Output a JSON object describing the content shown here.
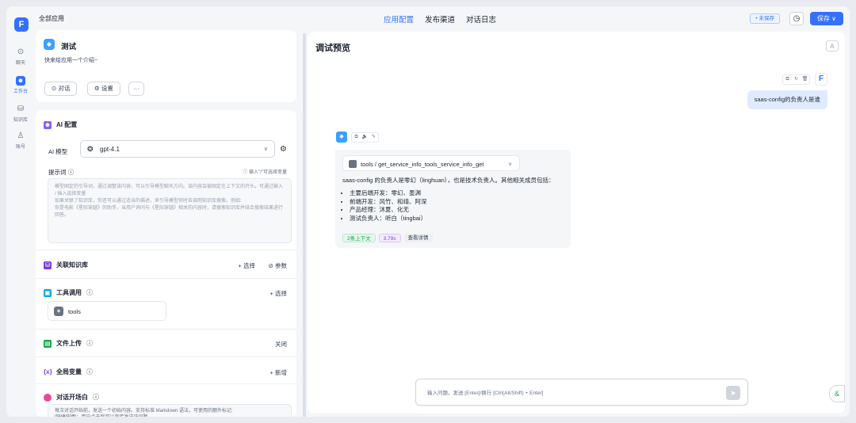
{
  "rail": {
    "logo": "F",
    "items": [
      {
        "label": "聊天",
        "icon": "chat-icon"
      },
      {
        "label": "工作台",
        "icon": "robot-icon"
      },
      {
        "label": "知识库",
        "icon": "database-icon"
      },
      {
        "label": "账号",
        "icon": "user-icon"
      }
    ]
  },
  "topbar": {
    "breadcrumb": "全部应用",
    "tabs": [
      "应用配置",
      "发布渠道",
      "对话日志"
    ],
    "active_tab": "应用配置",
    "unsaved": "• 未保存",
    "save": "保存 ∨"
  },
  "app": {
    "name": "测试",
    "intro": "快来给应用一个介绍~",
    "chat_button": "对话",
    "settings_button": "设置",
    "more_button": "···"
  },
  "ai_config": {
    "title": "AI 配置",
    "model_label": "AI 模型",
    "model_value": "gpt-4.1",
    "prompt_label": "提示词",
    "prompt_hint": "输入\"/\"可选择变量",
    "prompt_placeholder": "模型固定的引导词，通过调整该内容，可以引导模型聊天方向。该内容会被固定在上下文的开头。可通过输入 / 插入选择变量\n如果关联了知识库，你还可以通过适当的描述，来引导模型何时去调用知识库搜索。例如:\n你是电影《星际穿越》的助手，当用户询问与《星际穿越》相关的内容时，请搜索知识库并结合搜索结果进行回答。"
  },
  "sections": {
    "kb": {
      "title": "关联知识库",
      "select": "+ 选择",
      "params": "参数"
    },
    "tools": {
      "title": "工具调用",
      "select": "+ 选择",
      "item": "tools"
    },
    "file": {
      "title": "文件上传",
      "value": "关闭"
    },
    "vars": {
      "title": "全局变量",
      "add": "+ 新增"
    },
    "opening": {
      "title": "对话开场白",
      "text": "每次对话开始前，发送一个初始内容。支持标准 Markdown 语法，可使用的额外标记:\n[快捷按键]：用户点击后可以直接发送该问题"
    }
  },
  "preview": {
    "title": "调试预览",
    "user_message": "saas-config的负责人是谁",
    "tool_call": "tools / get_service_info_tools_service_info_get",
    "answer_intro": "saas-config 的负责人是零幻（linghuan），也是技术负责人。其他相关成员包括：",
    "answer_items": [
      "主要后端开发：零幻、墨渊",
      "前端开发：风竹、和靖、阿深",
      "产品经理：沐夏、化无",
      "测试负责人：听白（tingbai）"
    ],
    "tags": [
      "2条上下文",
      "3.79s",
      "查看详情"
    ],
    "input_placeholder": "输入问题，发送 [Enter]/换行 [Ctrl(Alt/Shift) + Enter]"
  }
}
